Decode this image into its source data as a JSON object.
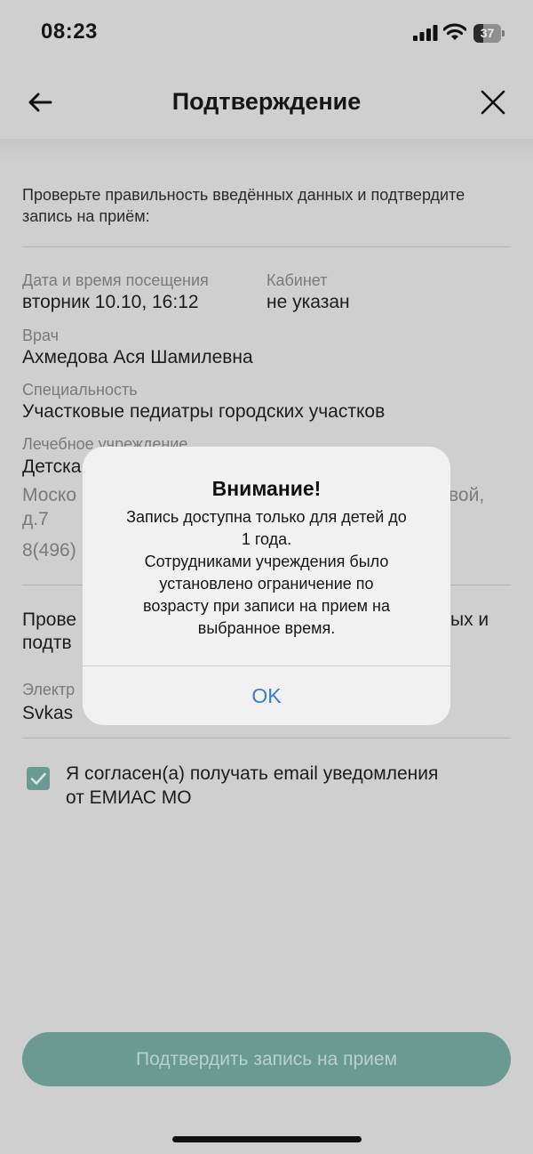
{
  "status_bar": {
    "time": "08:23",
    "battery": "37"
  },
  "header": {
    "title": "Подтверждение"
  },
  "intro": "Проверьте правильность введённых данных и подтвердите запись на приём:",
  "details": {
    "date_label": "Дата и время посещения",
    "date_value": "вторник 10.10, 16:12",
    "room_label": "Кабинет",
    "room_value": "не указан",
    "doctor_label": "Врач",
    "doctor_value": "Ахмедова Ася Шамилевна",
    "specialty_label": "Специальность",
    "specialty_value": "Участковые педиатры городских участков",
    "institution_label": "Лечебное учреждение",
    "institution_value_partial": "Детска",
    "address_partial_left": "Моско",
    "address_partial_right": "вой,",
    "address_line2": "д.7",
    "phone_partial": "8(496)"
  },
  "email_section": {
    "text_partial_line1_left": "Прове",
    "text_partial_line1_right": "ых и",
    "text_partial_line2": "подтв",
    "label_partial": "Электр",
    "value_partial": "Svkas"
  },
  "consent": {
    "label": "Я согласен(а) получать email уведомления от ЕМИАС МО",
    "checked": true
  },
  "confirm_button": "Подтвердить запись на прием",
  "alert": {
    "title": "Внимание!",
    "message": "Запись доступна только для детей до\n1 года.\nСотрудниками учреждения было\nустановлено ограничение по\nвозрасту при записи на прием на\nвыбранное время.",
    "ok": "OK"
  },
  "colors": {
    "accent": "#6a9a91",
    "link": "#3a7bd5"
  }
}
